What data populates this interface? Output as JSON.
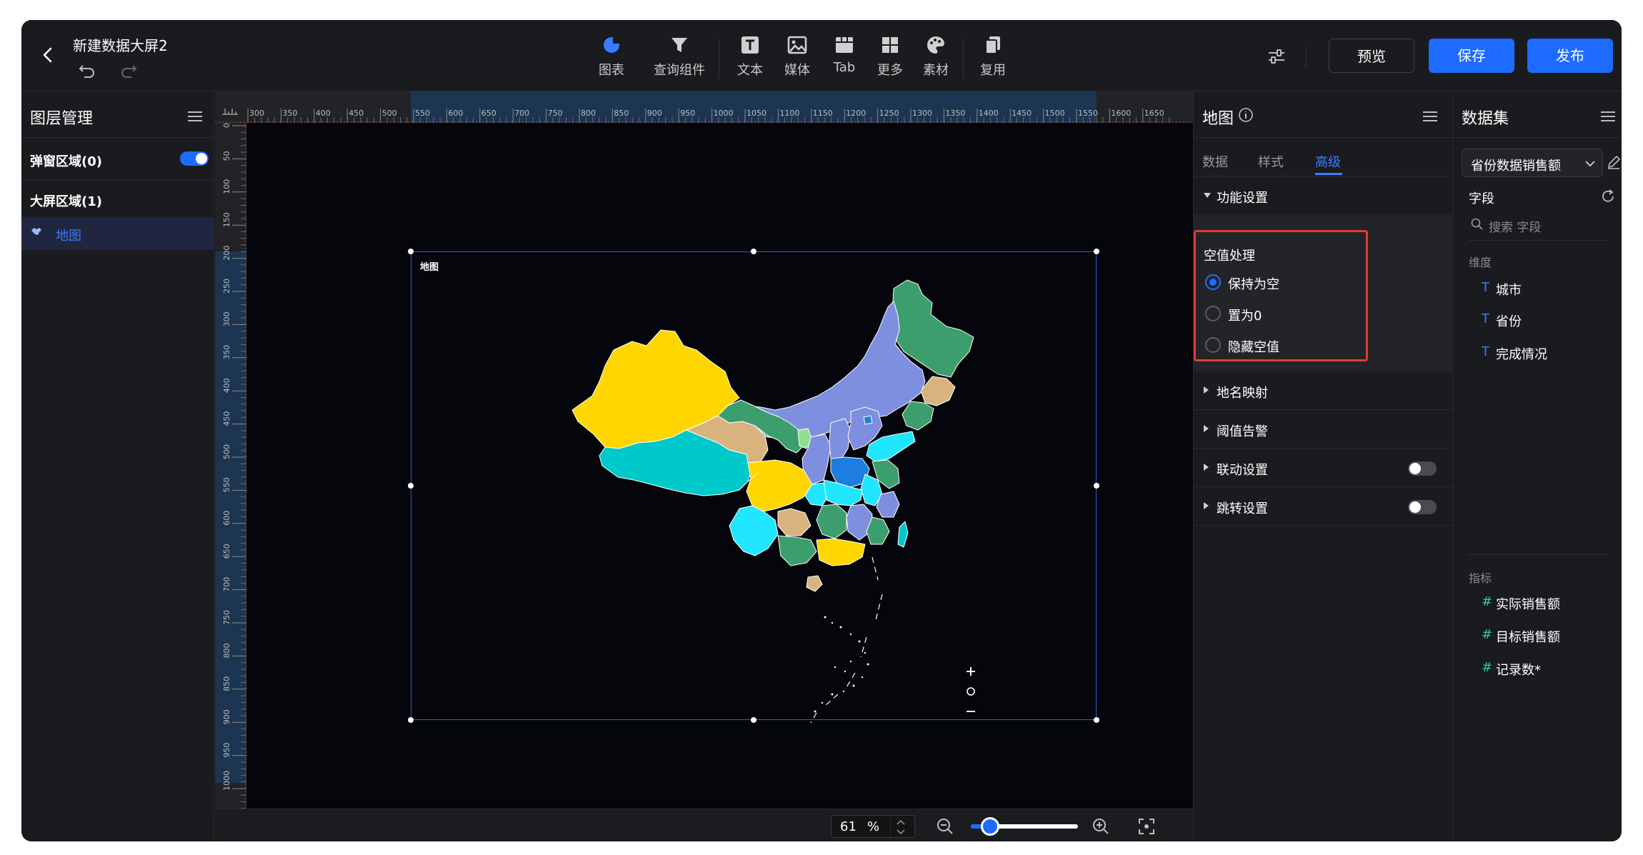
{
  "header": {
    "title": "新建数据大屏2",
    "tools": [
      {
        "label": "图表",
        "icon": "pie-chart-icon"
      },
      {
        "label": "查询组件",
        "icon": "filter-icon"
      },
      {
        "label": "文本",
        "icon": "text-icon"
      },
      {
        "label": "媒体",
        "icon": "image-icon"
      },
      {
        "label": "Tab",
        "icon": "tab-icon"
      },
      {
        "label": "更多",
        "icon": "grid-icon"
      },
      {
        "label": "素材",
        "icon": "palette-icon"
      },
      {
        "label": "复用",
        "icon": "copy-icon"
      }
    ],
    "preview_label": "预览",
    "save_label": "保存",
    "publish_label": "发布"
  },
  "layers": {
    "title": "图层管理",
    "popup_area": "弹窗区域(0)",
    "popup_toggle_on": true,
    "screen_area": "大屏区域(1)",
    "items": [
      {
        "label": "地图",
        "selected": true
      }
    ]
  },
  "canvas": {
    "ruler_top_ticks": [
      "300",
      "350",
      "400",
      "450",
      "500",
      "550",
      "600",
      "650",
      "700",
      "750",
      "800",
      "850",
      "900",
      "950",
      "1000",
      "1050",
      "1100",
      "1150",
      "1200",
      "1250",
      "1300",
      "1350",
      "1400",
      "1450",
      "1500",
      "1550",
      "1600",
      "1650"
    ],
    "ruler_left_ticks": [
      "0",
      "50",
      "100",
      "150",
      "200",
      "250",
      "300",
      "350",
      "400",
      "450",
      "500",
      "550",
      "600",
      "650",
      "700",
      "750",
      "800",
      "850",
      "900",
      "950",
      "1000"
    ],
    "component_label": "地图",
    "zoom_value": "61",
    "zoom_unit": "%",
    "zoom_level": 0.18
  },
  "props": {
    "title": "地图",
    "tabs": [
      {
        "label": "数据"
      },
      {
        "label": "样式"
      },
      {
        "label": "高级",
        "active": true
      }
    ],
    "feature_section": "功能设置",
    "null_handling": {
      "title": "空值处理",
      "options": [
        {
          "label": "保持为空",
          "selected": true
        },
        {
          "label": "置为0",
          "selected": false
        },
        {
          "label": "隐藏空值",
          "selected": false
        }
      ]
    },
    "sections": [
      {
        "label": "地名映射",
        "has_toggle": false
      },
      {
        "label": "阈值告警",
        "has_toggle": false
      },
      {
        "label": "联动设置",
        "has_toggle": true
      },
      {
        "label": "跳转设置",
        "has_toggle": true
      }
    ]
  },
  "dataset": {
    "title": "数据集",
    "selected": "省份数据销售额",
    "fields_title": "字段",
    "search_placeholder": "搜索 字段",
    "dimensions_title": "维度",
    "dimensions": [
      "城市",
      "省份",
      "完成情况"
    ],
    "metrics_title": "指标",
    "metrics": [
      "实际销售额",
      "目标销售额",
      "记录数*"
    ]
  },
  "colors": {
    "accent": "#1e6bff",
    "map_yellow": "#ffd600",
    "map_teal": "#00c9c9",
    "map_tan": "#d9b37e",
    "map_green": "#3c9e6d",
    "map_purple": "#7e8fe0",
    "map_cyan": "#21e6ff",
    "map_blue": "#1e7de0",
    "highlight_red": "#e53935"
  }
}
